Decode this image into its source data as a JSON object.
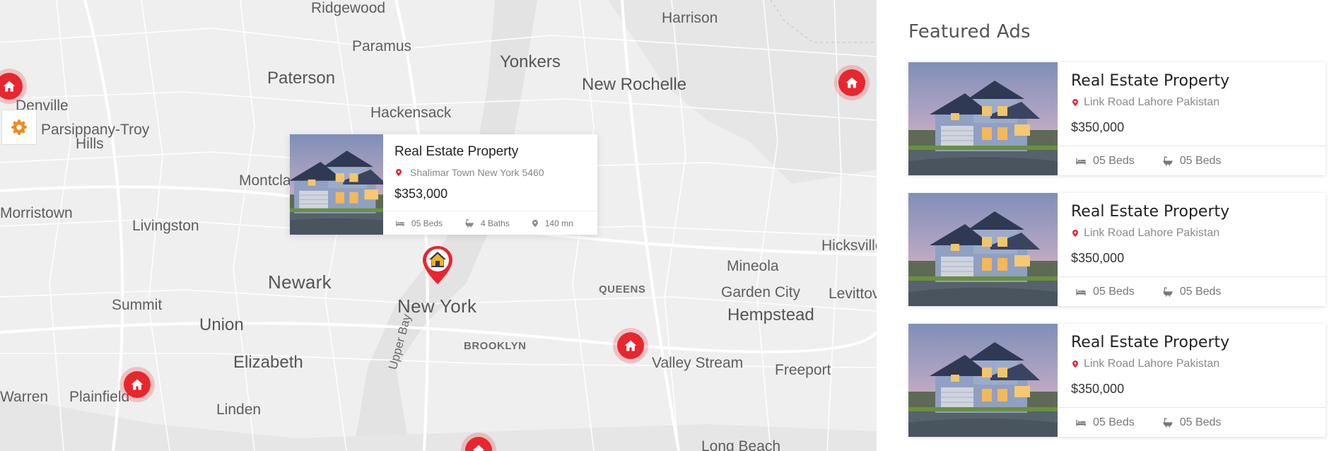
{
  "map": {
    "places": [
      {
        "id": "ridgewood",
        "label": "Ridgewood"
      },
      {
        "id": "harrison",
        "label": "Harrison"
      },
      {
        "id": "paramus",
        "label": "Paramus"
      },
      {
        "id": "yonkers",
        "label": "Yonkers"
      },
      {
        "id": "paterson",
        "label": "Paterson"
      },
      {
        "id": "new-rochelle",
        "label": "New Rochelle"
      },
      {
        "id": "denville",
        "label": "Denville"
      },
      {
        "id": "parsippany",
        "label": "Parsippany-Troy"
      },
      {
        "id": "hills",
        "label": "Hills"
      },
      {
        "id": "hackensack",
        "label": "Hackensack"
      },
      {
        "id": "montclair",
        "label": "Montcla"
      },
      {
        "id": "morristown",
        "label": "Morristown"
      },
      {
        "id": "livingston",
        "label": "Livingston"
      },
      {
        "id": "hicksville",
        "label": "Hicksville"
      },
      {
        "id": "mineola",
        "label": "Mineola"
      },
      {
        "id": "newark",
        "label": "Newark"
      },
      {
        "id": "queens",
        "label": "QUEENS"
      },
      {
        "id": "garden-city",
        "label": "Garden City"
      },
      {
        "id": "levittown",
        "label": "Levittov"
      },
      {
        "id": "summit",
        "label": "Summit"
      },
      {
        "id": "new-york",
        "label": "New York"
      },
      {
        "id": "hempstead",
        "label": "Hempstead"
      },
      {
        "id": "union",
        "label": "Union"
      },
      {
        "id": "brooklyn",
        "label": "BROOKLYN"
      },
      {
        "id": "upper-bay",
        "label": "Upper Bay"
      },
      {
        "id": "elizabeth",
        "label": "Elizabeth"
      },
      {
        "id": "valley-stream",
        "label": "Valley Stream"
      },
      {
        "id": "freeport",
        "label": "Freeport"
      },
      {
        "id": "warren",
        "label": "Warren"
      },
      {
        "id": "plainfield",
        "label": "Plainfield"
      },
      {
        "id": "linden",
        "label": "Linden"
      },
      {
        "id": "long-beach",
        "label": "Long Beach"
      }
    ],
    "popup": {
      "title": "Real Estate Property",
      "address": "Shalimar Town New York 5460",
      "price": "$353,000",
      "beds": "05 Beds",
      "baths": "4 Baths",
      "distance": "140 mn"
    },
    "accent_color": "#e8262e"
  },
  "sidebar": {
    "heading": "Featured Ads",
    "ads": [
      {
        "title": "Real Estate Property",
        "address": "Link Road Lahore Pakistan",
        "price": "$350,000",
        "beds": "05 Beds",
        "baths": "05 Beds"
      },
      {
        "title": "Real Estate Property",
        "address": "Link Road Lahore Pakistan",
        "price": "$350,000",
        "beds": "05 Beds",
        "baths": "05 Beds"
      },
      {
        "title": "Real Estate Property",
        "address": "Link Road Lahore Pakistan",
        "price": "$350,000",
        "beds": "05 Beds",
        "baths": "05 Beds"
      }
    ]
  }
}
